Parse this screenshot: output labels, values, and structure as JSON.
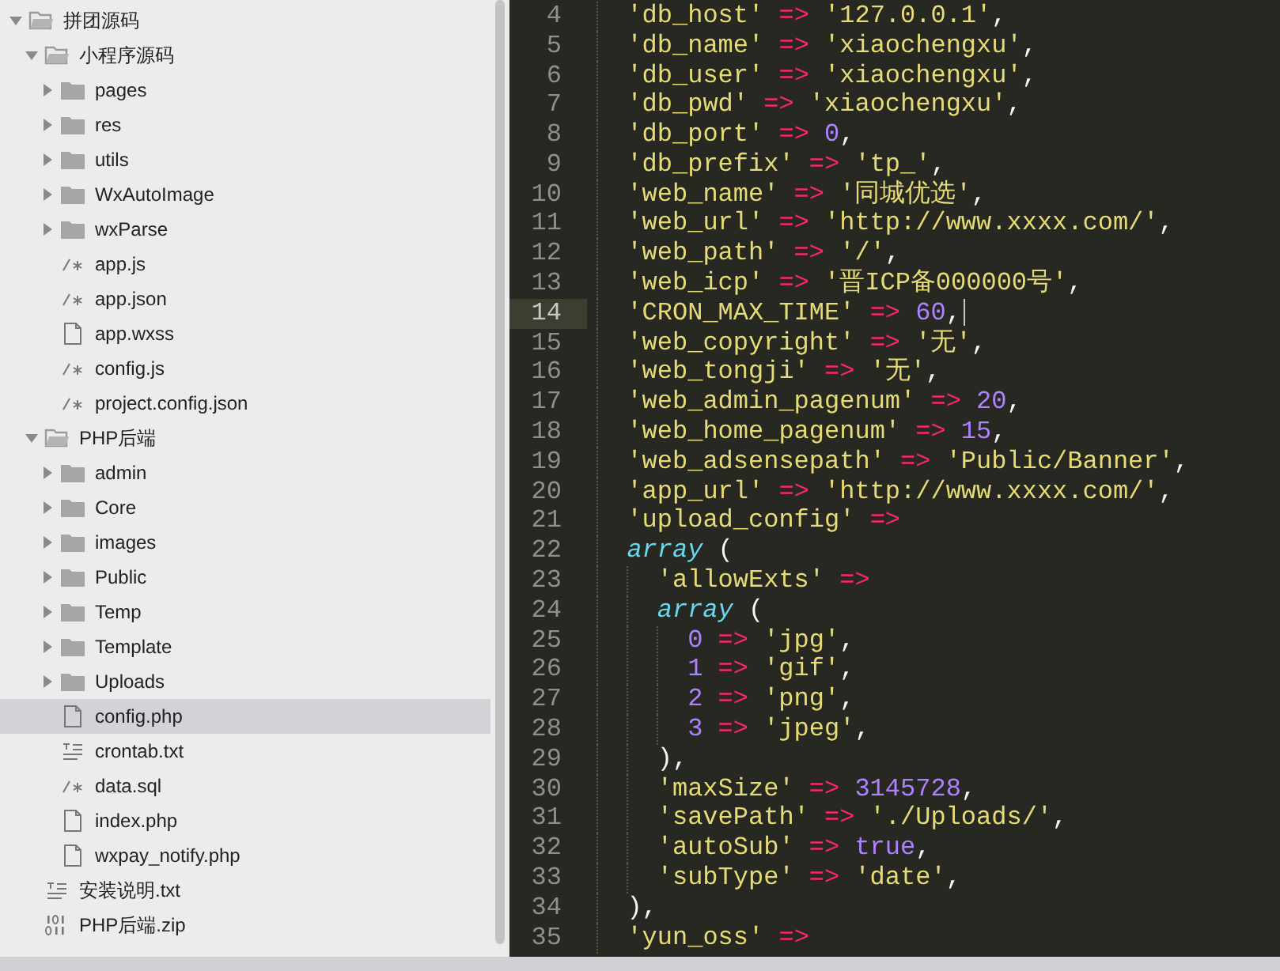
{
  "sidebar": {
    "tree": [
      {
        "name": "拼团源码",
        "kind": "folder",
        "expanded": true,
        "selected": false,
        "children": [
          {
            "name": "小程序源码",
            "kind": "folder",
            "expanded": true,
            "selected": false,
            "children": [
              {
                "name": "pages",
                "kind": "folder",
                "expanded": false,
                "selected": false
              },
              {
                "name": "res",
                "kind": "folder",
                "expanded": false,
                "selected": false
              },
              {
                "name": "utils",
                "kind": "folder",
                "expanded": false,
                "selected": false
              },
              {
                "name": "WxAutoImage",
                "kind": "folder",
                "expanded": false,
                "selected": false
              },
              {
                "name": "wxParse",
                "kind": "folder",
                "expanded": false,
                "selected": false
              },
              {
                "name": "app.js",
                "kind": "code",
                "selected": false
              },
              {
                "name": "app.json",
                "kind": "code",
                "selected": false
              },
              {
                "name": "app.wxss",
                "kind": "doc",
                "selected": false
              },
              {
                "name": "config.js",
                "kind": "code",
                "selected": false
              },
              {
                "name": "project.config.json",
                "kind": "code",
                "selected": false
              }
            ]
          },
          {
            "name": "PHP后端",
            "kind": "folder",
            "expanded": true,
            "selected": false,
            "children": [
              {
                "name": "admin",
                "kind": "folder",
                "expanded": false,
                "selected": false
              },
              {
                "name": "Core",
                "kind": "folder",
                "expanded": false,
                "selected": false
              },
              {
                "name": "images",
                "kind": "folder",
                "expanded": false,
                "selected": false
              },
              {
                "name": "Public",
                "kind": "folder",
                "expanded": false,
                "selected": false
              },
              {
                "name": "Temp",
                "kind": "folder",
                "expanded": false,
                "selected": false
              },
              {
                "name": "Template",
                "kind": "folder",
                "expanded": false,
                "selected": false
              },
              {
                "name": "Uploads",
                "kind": "folder",
                "expanded": false,
                "selected": false
              },
              {
                "name": "config.php",
                "kind": "doc",
                "selected": true
              },
              {
                "name": "crontab.txt",
                "kind": "text",
                "selected": false
              },
              {
                "name": "data.sql",
                "kind": "code",
                "selected": false
              },
              {
                "name": "index.php",
                "kind": "doc",
                "selected": false
              },
              {
                "name": "wxpay_notify.php",
                "kind": "doc",
                "selected": false
              }
            ]
          },
          {
            "name": "安装说明.txt",
            "kind": "text",
            "selected": false
          },
          {
            "name": "PHP后端.zip",
            "kind": "binary",
            "selected": false
          }
        ]
      }
    ]
  },
  "editor": {
    "lines": [
      {
        "number": "4",
        "current": false,
        "tokens": [
          {
            "kind": "str",
            "text": "'db_host'"
          },
          {
            "kind": "op",
            "text": " => "
          },
          {
            "kind": "str",
            "text": "'127.0.0.1'"
          },
          {
            "kind": "punct",
            "text": ","
          }
        ]
      },
      {
        "number": "5",
        "current": false,
        "tokens": [
          {
            "kind": "str",
            "text": "'db_name'"
          },
          {
            "kind": "op",
            "text": " => "
          },
          {
            "kind": "str",
            "text": "'xiaochengxu'"
          },
          {
            "kind": "punct",
            "text": ","
          }
        ]
      },
      {
        "number": "6",
        "current": false,
        "tokens": [
          {
            "kind": "str",
            "text": "'db_user'"
          },
          {
            "kind": "op",
            "text": " => "
          },
          {
            "kind": "str",
            "text": "'xiaochengxu'"
          },
          {
            "kind": "punct",
            "text": ","
          }
        ]
      },
      {
        "number": "7",
        "current": false,
        "tokens": [
          {
            "kind": "str",
            "text": "'db_pwd'"
          },
          {
            "kind": "op",
            "text": " => "
          },
          {
            "kind": "str",
            "text": "'xiaochengxu'"
          },
          {
            "kind": "punct",
            "text": ","
          }
        ]
      },
      {
        "number": "8",
        "current": false,
        "tokens": [
          {
            "kind": "str",
            "text": "'db_port'"
          },
          {
            "kind": "op",
            "text": " => "
          },
          {
            "kind": "num",
            "text": "0"
          },
          {
            "kind": "punct",
            "text": ","
          }
        ]
      },
      {
        "number": "9",
        "current": false,
        "tokens": [
          {
            "kind": "str",
            "text": "'db_prefix'"
          },
          {
            "kind": "op",
            "text": " => "
          },
          {
            "kind": "str",
            "text": "'tp_'"
          },
          {
            "kind": "punct",
            "text": ","
          }
        ]
      },
      {
        "number": "10",
        "current": false,
        "tokens": [
          {
            "kind": "str",
            "text": "'web_name'"
          },
          {
            "kind": "op",
            "text": " => "
          },
          {
            "kind": "str",
            "text": "'同城优选'"
          },
          {
            "kind": "punct",
            "text": ","
          }
        ]
      },
      {
        "number": "11",
        "current": false,
        "tokens": [
          {
            "kind": "str",
            "text": "'web_url'"
          },
          {
            "kind": "op",
            "text": " => "
          },
          {
            "kind": "str",
            "text": "'http://www.xxxx.com/'"
          },
          {
            "kind": "punct",
            "text": ","
          }
        ]
      },
      {
        "number": "12",
        "current": false,
        "tokens": [
          {
            "kind": "str",
            "text": "'web_path'"
          },
          {
            "kind": "op",
            "text": " => "
          },
          {
            "kind": "str",
            "text": "'/'"
          },
          {
            "kind": "punct",
            "text": ","
          }
        ]
      },
      {
        "number": "13",
        "current": false,
        "tokens": [
          {
            "kind": "str",
            "text": "'web_icp'"
          },
          {
            "kind": "op",
            "text": " => "
          },
          {
            "kind": "str",
            "text": "'晋ICP备000000号'"
          },
          {
            "kind": "punct",
            "text": ","
          }
        ]
      },
      {
        "number": "14",
        "current": true,
        "tokens": [
          {
            "kind": "str",
            "text": "'CRON_MAX_TIME'"
          },
          {
            "kind": "op",
            "text": " => "
          },
          {
            "kind": "num",
            "text": "60"
          },
          {
            "kind": "punct",
            "text": ","
          }
        ]
      },
      {
        "number": "15",
        "current": false,
        "tokens": [
          {
            "kind": "str",
            "text": "'web_copyright'"
          },
          {
            "kind": "op",
            "text": " => "
          },
          {
            "kind": "str",
            "text": "'无'"
          },
          {
            "kind": "punct",
            "text": ","
          }
        ]
      },
      {
        "number": "16",
        "current": false,
        "tokens": [
          {
            "kind": "str",
            "text": "'web_tongji'"
          },
          {
            "kind": "op",
            "text": " => "
          },
          {
            "kind": "str",
            "text": "'无'"
          },
          {
            "kind": "punct",
            "text": ","
          }
        ]
      },
      {
        "number": "17",
        "current": false,
        "tokens": [
          {
            "kind": "str",
            "text": "'web_admin_pagenum'"
          },
          {
            "kind": "op",
            "text": " => "
          },
          {
            "kind": "num",
            "text": "20"
          },
          {
            "kind": "punct",
            "text": ","
          }
        ]
      },
      {
        "number": "18",
        "current": false,
        "tokens": [
          {
            "kind": "str",
            "text": "'web_home_pagenum'"
          },
          {
            "kind": "op",
            "text": " => "
          },
          {
            "kind": "num",
            "text": "15"
          },
          {
            "kind": "punct",
            "text": ","
          }
        ]
      },
      {
        "number": "19",
        "current": false,
        "tokens": [
          {
            "kind": "str",
            "text": "'web_adsensepath'"
          },
          {
            "kind": "op",
            "text": " => "
          },
          {
            "kind": "str",
            "text": "'Public/Banner'"
          },
          {
            "kind": "punct",
            "text": ","
          }
        ]
      },
      {
        "number": "20",
        "current": false,
        "tokens": [
          {
            "kind": "str",
            "text": "'app_url'"
          },
          {
            "kind": "op",
            "text": " => "
          },
          {
            "kind": "str",
            "text": "'http://www.xxxx.com/'"
          },
          {
            "kind": "punct",
            "text": ","
          }
        ]
      },
      {
        "number": "21",
        "current": false,
        "tokens": [
          {
            "kind": "str",
            "text": "'upload_config'"
          },
          {
            "kind": "op",
            "text": " =>"
          }
        ]
      },
      {
        "number": "22",
        "current": false,
        "tokens": [
          {
            "kind": "kw",
            "text": "array"
          },
          {
            "kind": "punct",
            "text": " ("
          }
        ],
        "children": [
          {
            "number": "23",
            "current": false,
            "tokens": [
              {
                "kind": "str",
                "text": "'allowExts'"
              },
              {
                "kind": "op",
                "text": " =>"
              }
            ]
          },
          {
            "number": "24",
            "current": false,
            "tokens": [
              {
                "kind": "kw",
                "text": "array"
              },
              {
                "kind": "punct",
                "text": " ("
              }
            ],
            "children": [
              {
                "number": "25",
                "current": false,
                "tokens": [
                  {
                    "kind": "num",
                    "text": "0"
                  },
                  {
                    "kind": "op",
                    "text": " => "
                  },
                  {
                    "kind": "str",
                    "text": "'jpg'"
                  },
                  {
                    "kind": "punct",
                    "text": ","
                  }
                ]
              },
              {
                "number": "26",
                "current": false,
                "tokens": [
                  {
                    "kind": "num",
                    "text": "1"
                  },
                  {
                    "kind": "op",
                    "text": " => "
                  },
                  {
                    "kind": "str",
                    "text": "'gif'"
                  },
                  {
                    "kind": "punct",
                    "text": ","
                  }
                ]
              },
              {
                "number": "27",
                "current": false,
                "tokens": [
                  {
                    "kind": "num",
                    "text": "2"
                  },
                  {
                    "kind": "op",
                    "text": " => "
                  },
                  {
                    "kind": "str",
                    "text": "'png'"
                  },
                  {
                    "kind": "punct",
                    "text": ","
                  }
                ]
              },
              {
                "number": "28",
                "current": false,
                "tokens": [
                  {
                    "kind": "num",
                    "text": "3"
                  },
                  {
                    "kind": "op",
                    "text": " => "
                  },
                  {
                    "kind": "str",
                    "text": "'jpeg'"
                  },
                  {
                    "kind": "punct",
                    "text": ","
                  }
                ]
              }
            ]
          },
          {
            "number": "29",
            "current": false,
            "tokens": [
              {
                "kind": "punct",
                "text": "),"
              }
            ]
          },
          {
            "number": "30",
            "current": false,
            "tokens": [
              {
                "kind": "str",
                "text": "'maxSize'"
              },
              {
                "kind": "op",
                "text": " => "
              },
              {
                "kind": "num",
                "text": "3145728"
              },
              {
                "kind": "punct",
                "text": ","
              }
            ]
          },
          {
            "number": "31",
            "current": false,
            "tokens": [
              {
                "kind": "str",
                "text": "'savePath'"
              },
              {
                "kind": "op",
                "text": " => "
              },
              {
                "kind": "str",
                "text": "'./Uploads/'"
              },
              {
                "kind": "punct",
                "text": ","
              }
            ]
          },
          {
            "number": "32",
            "current": false,
            "tokens": [
              {
                "kind": "str",
                "text": "'autoSub'"
              },
              {
                "kind": "op",
                "text": " => "
              },
              {
                "kind": "num",
                "text": "true"
              },
              {
                "kind": "punct",
                "text": ","
              }
            ]
          },
          {
            "number": "33",
            "current": false,
            "tokens": [
              {
                "kind": "str",
                "text": "'subType'"
              },
              {
                "kind": "op",
                "text": " => "
              },
              {
                "kind": "str",
                "text": "'date'"
              },
              {
                "kind": "punct",
                "text": ","
              }
            ]
          }
        ]
      },
      {
        "number": "34",
        "current": false,
        "tokens": [
          {
            "kind": "punct",
            "text": "),"
          }
        ]
      },
      {
        "number": "35",
        "current": false,
        "tokens": [
          {
            "kind": "str",
            "text": "'yun_oss'"
          },
          {
            "kind": "op",
            "text": " =>"
          }
        ]
      }
    ]
  }
}
